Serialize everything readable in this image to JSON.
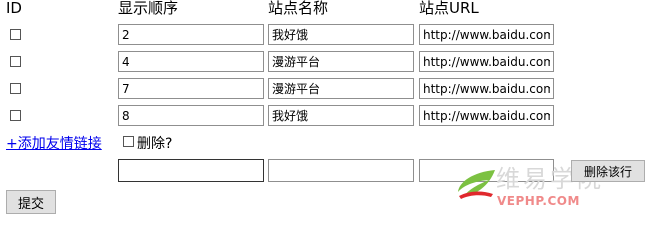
{
  "headers": {
    "id": "ID",
    "order": "显示顺序",
    "name": "站点名称",
    "url": "站点URL"
  },
  "rows": [
    {
      "order": "2",
      "name": "我好饿",
      "url": "http://www.baidu.com",
      "checked": false
    },
    {
      "order": "4",
      "name": "漫游平台",
      "url": "http://www.baidu.com",
      "checked": false
    },
    {
      "order": "7",
      "name": "漫游平台",
      "url": "http://www.baidu.com",
      "checked": false
    },
    {
      "order": "8",
      "name": "我好饿",
      "url": "http://www.baidu.com",
      "checked": false
    }
  ],
  "add_link": "+添加友情链接",
  "delete_label": "删除?",
  "new_row": {
    "order": "",
    "name": "",
    "url": ""
  },
  "delete_row_button": "删除该行",
  "submit_button": "提交",
  "watermark": {
    "cn": "维易学院",
    "en": "VEPHP.COM",
    "green": "#7cc142",
    "red": "#e0282d"
  }
}
